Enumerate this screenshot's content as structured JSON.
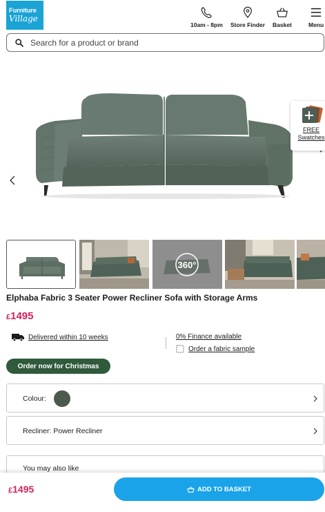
{
  "header": {
    "logo_line1": "Furniture",
    "logo_line2": "Village",
    "nav": [
      {
        "label": "10am - 8pm",
        "icon": "phone-icon"
      },
      {
        "label": "Store Finder",
        "icon": "location-pin-icon"
      },
      {
        "label": "Basket",
        "icon": "basket-icon"
      },
      {
        "label": "Menu",
        "icon": "hamburger-menu-icon"
      }
    ]
  },
  "search": {
    "placeholder": "Search for a product or brand"
  },
  "gallery": {
    "swatch_line1": "FREE",
    "swatch_line2": "Swatches",
    "thumb_360_label": "360°"
  },
  "product": {
    "title": "Elphaba Fabric 3 Seater Power Recliner Sofa with Storage Arms",
    "currency": "£",
    "price": "1495",
    "delivery": "Delivered within 10 weeks",
    "finance": "0% Finance available",
    "fabric_sample": "Order a fabric sample",
    "promo_badge": "Order now for Christmas"
  },
  "options": {
    "colour_label": "Colour:",
    "colour_swatch": "#4b5a4c",
    "recliner_label": "Recliner: Power Recliner",
    "also_like_label": "You may also like"
  },
  "sticky_bar": {
    "currency": "£",
    "price": "1495",
    "add_to_basket": "ADD TO BASKET"
  },
  "colors": {
    "brand_blue": "#1aa3d4",
    "price_pink": "#d1245c",
    "promo_green": "#2f5a3b",
    "button_blue": "#1aa3e8"
  }
}
